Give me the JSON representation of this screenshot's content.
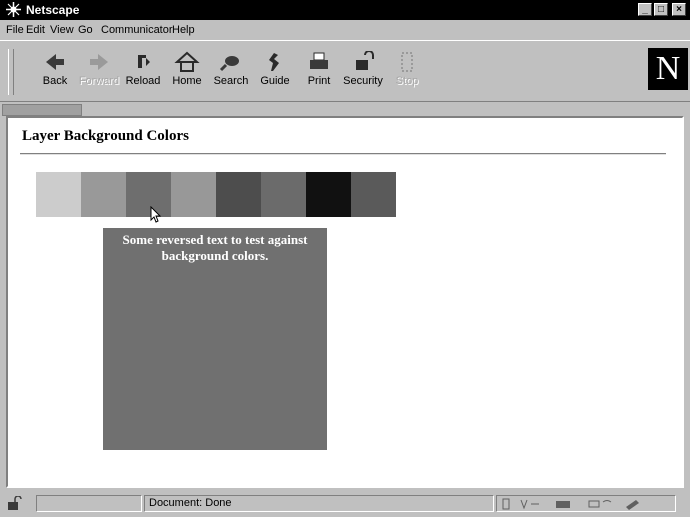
{
  "window": {
    "title": "Netscape"
  },
  "menu": [
    "File",
    "Edit",
    "View",
    "Go",
    "Communicator",
    "Help"
  ],
  "toolbar": {
    "buttons": [
      {
        "label": "Back",
        "enabled": true
      },
      {
        "label": "Forward",
        "enabled": false
      },
      {
        "label": "Reload",
        "enabled": true
      },
      {
        "label": "Home",
        "enabled": true
      },
      {
        "label": "Search",
        "enabled": true
      },
      {
        "label": "Guide",
        "enabled": true
      },
      {
        "label": "Print",
        "enabled": true
      },
      {
        "label": "Security",
        "enabled": true
      },
      {
        "label": "Stop",
        "enabled": false
      }
    ],
    "logo_letter": "N"
  },
  "page": {
    "title": "Layer Background Colors",
    "swatch_colors": [
      "#cccccc",
      "#999999",
      "#6e6e6e",
      "#989898",
      "#4d4d4d",
      "#6b6b6b",
      "#111111",
      "#5a5a5a"
    ],
    "layer_color": "#707070",
    "layer_text": "Some reversed text to test against background colors."
  },
  "status": {
    "text": "Document: Done"
  }
}
